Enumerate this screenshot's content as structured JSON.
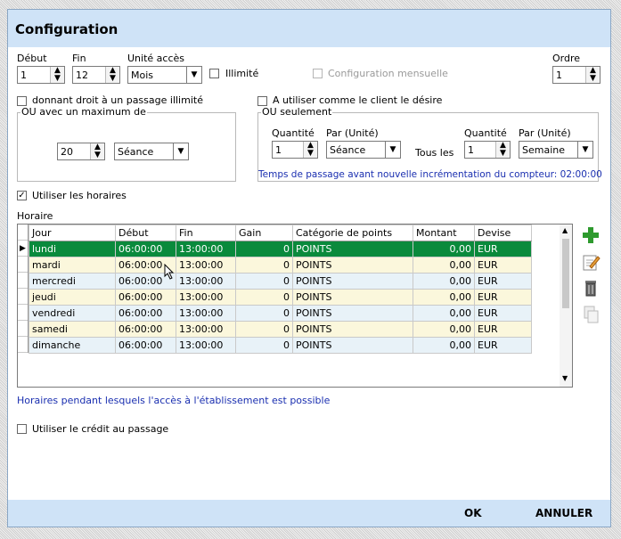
{
  "dialog": {
    "title": "Configuration"
  },
  "top": {
    "debut_label": "Début",
    "debut_value": "1",
    "fin_label": "Fin",
    "fin_value": "12",
    "unite_label": "Unité accès",
    "unite_value": "Mois",
    "illimite_label": "Illimité",
    "config_mensuelle_label": "Configuration mensuelle",
    "ordre_label": "Ordre",
    "ordre_value": "1"
  },
  "left_group": {
    "check_label": "donnant droit à un passage illimité",
    "legend": "OU avec un maximum de",
    "qty_value": "20",
    "unit_value": "Séance"
  },
  "right_group": {
    "check_label": "A utiliser comme le client le désire",
    "legend": "OU seulement",
    "qty1_label": "Quantité",
    "qty1_value": "1",
    "par1_label": "Par (Unité)",
    "par1_value": "Séance",
    "tous_les": "Tous les",
    "qty2_label": "Quantité",
    "qty2_value": "1",
    "par2_label": "Par (Unité)",
    "par2_value": "Semaine",
    "info": "Temps de passage avant nouvelle incrémentation du compteur: 02:00:00"
  },
  "horaires": {
    "use_label": "Utiliser les horaires",
    "section_label": "Horaire",
    "columns": [
      "Jour",
      "Début",
      "Fin",
      "Gain",
      "Catégorie de points",
      "Montant",
      "Devise"
    ],
    "rows": [
      [
        "lundi",
        "06:00:00",
        "13:00:00",
        "0",
        "POINTS",
        "0,00",
        "EUR"
      ],
      [
        "mardi",
        "06:00:00",
        "13:00:00",
        "0",
        "POINTS",
        "0,00",
        "EUR"
      ],
      [
        "mercredi",
        "06:00:00",
        "13:00:00",
        "0",
        "POINTS",
        "0,00",
        "EUR"
      ],
      [
        "jeudi",
        "06:00:00",
        "13:00:00",
        "0",
        "POINTS",
        "0,00",
        "EUR"
      ],
      [
        "vendredi",
        "06:00:00",
        "13:00:00",
        "0",
        "POINTS",
        "0,00",
        "EUR"
      ],
      [
        "samedi",
        "06:00:00",
        "13:00:00",
        "0",
        "POINTS",
        "0,00",
        "EUR"
      ],
      [
        "dimanche",
        "06:00:00",
        "13:00:00",
        "0",
        "POINTS",
        "0,00",
        "EUR"
      ]
    ],
    "note": "Horaires pendant lesquels l'accès à l'établissement est possible"
  },
  "credit": {
    "label": "Utiliser le crédit au passage"
  },
  "footer": {
    "ok": "OK",
    "cancel": "ANNULER"
  },
  "colors": {
    "titlebar": "#cfe3f7",
    "selected_row": "#0a8a3c",
    "link_text": "#1a2fb0"
  },
  "icons": [
    "add-icon",
    "edit-icon",
    "trash-icon",
    "copy-icon"
  ]
}
